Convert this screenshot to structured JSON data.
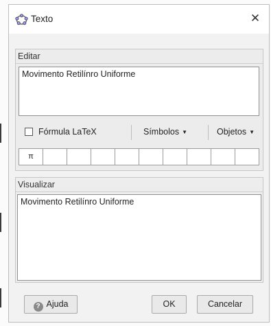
{
  "window": {
    "title": "Texto"
  },
  "edit": {
    "label": "Editar",
    "content": "Movimento Retilínro Uniforme",
    "latex_label": "Fórmula LaTeX",
    "latex_checked": false,
    "symbols_label": "Símbolos",
    "objects_label": "Objetos",
    "keys": [
      "π",
      "",
      "",
      "",
      "",
      "",
      "",
      "",
      "",
      ""
    ]
  },
  "preview": {
    "label": "Visualizar",
    "content": "Movimento Retilínro Uniforme"
  },
  "buttons": {
    "help": "Ajuda",
    "ok": "OK",
    "cancel": "Cancelar"
  },
  "icons": {
    "title": "geogebra-logo-icon",
    "close": "close-icon",
    "help": "help-icon",
    "dropdown": "caret-down-icon"
  }
}
